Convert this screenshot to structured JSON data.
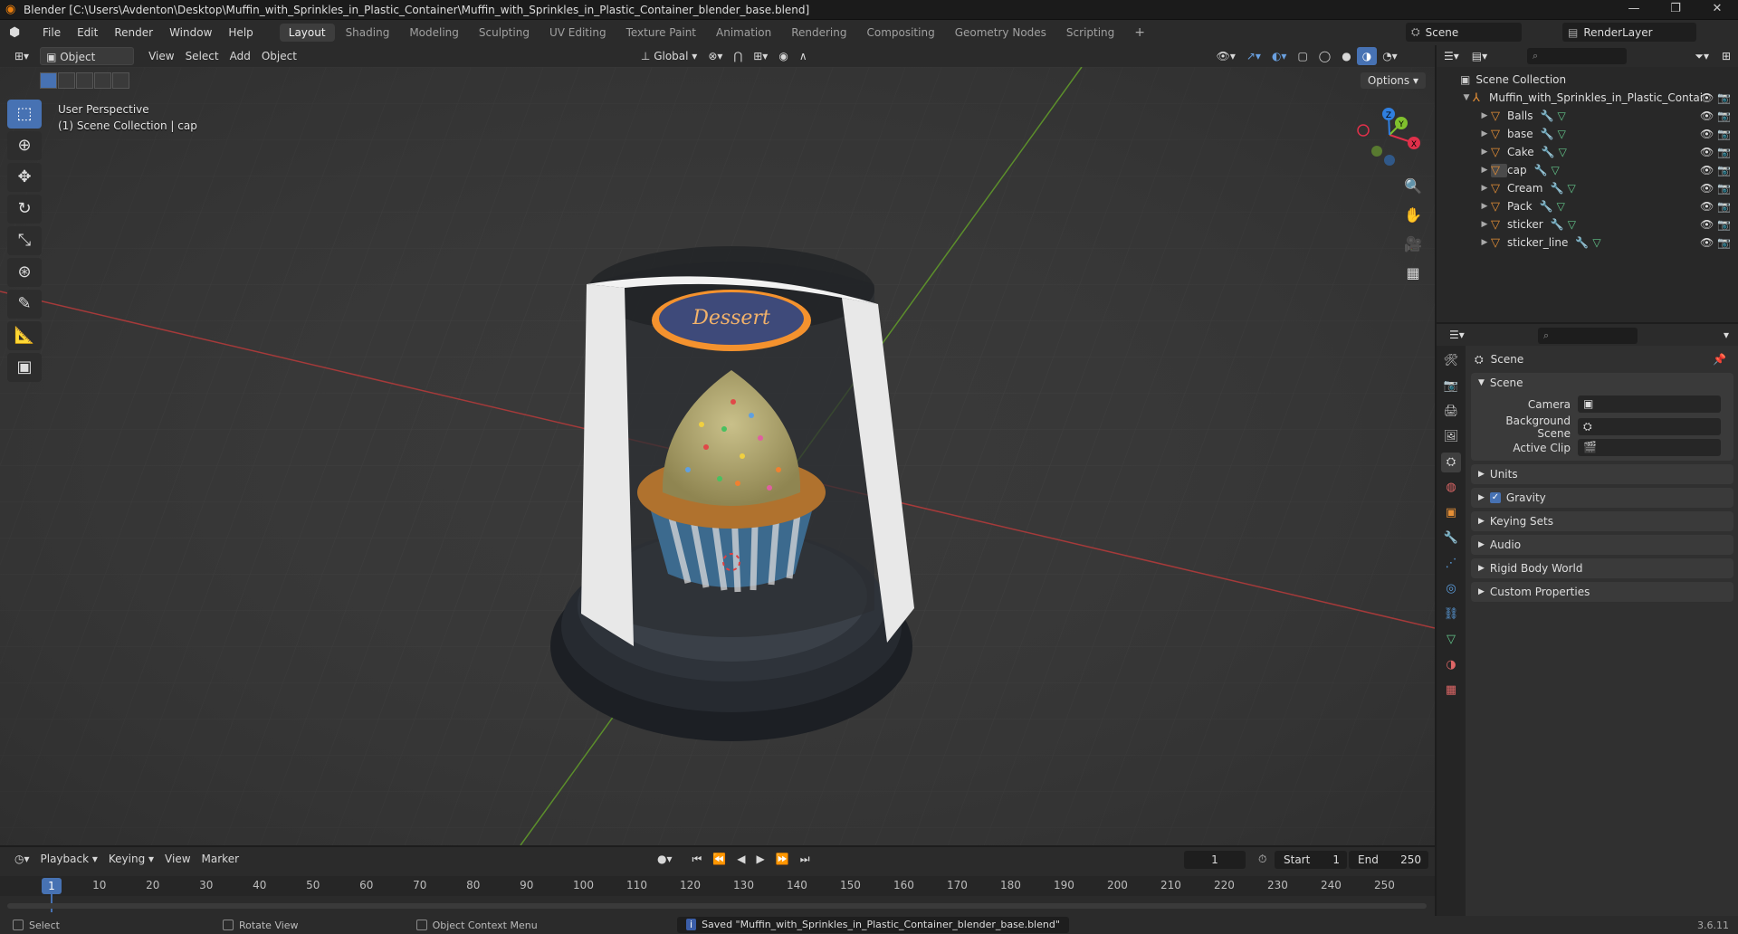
{
  "window": {
    "title": "Blender [C:\\Users\\Avdenton\\Desktop\\Muffin_with_Sprinkles_in_Plastic_Container\\Muffin_with_Sprinkles_in_Plastic_Container_blender_base.blend]",
    "minimize": "—",
    "maximize": "❐",
    "close": "✕"
  },
  "menu": [
    "File",
    "Edit",
    "Render",
    "Window",
    "Help"
  ],
  "workspaces": [
    "Layout",
    "Shading",
    "Modeling",
    "Sculpting",
    "UV Editing",
    "Texture Paint",
    "Animation",
    "Rendering",
    "Compositing",
    "Geometry Nodes",
    "Scripting"
  ],
  "workspace_add": "+",
  "scene_selector": "Scene",
  "view_layer": "RenderLayer",
  "header": {
    "mode": "Object Mode",
    "view": "View",
    "select": "Select",
    "add": "Add",
    "object": "Object",
    "transform_orientation": "Global",
    "options": "Options"
  },
  "viewport": {
    "perspective": "User Perspective",
    "collection_info": "(1) Scene Collection | cap",
    "sticker_text": "Dessert"
  },
  "outliner": {
    "search_placeholder": "",
    "root": "Scene Collection",
    "collection": "Muffin_with_Sprinkles_in_Plastic_Contai",
    "items": [
      "Balls",
      "base",
      "Cake",
      "cap",
      "Cream",
      "Pack",
      "sticker",
      "sticker_line"
    ],
    "selected": "cap"
  },
  "properties": {
    "context": "Scene",
    "panel_scene": "Scene",
    "camera_label": "Camera",
    "background_scene_label": "Background Scene",
    "active_clip_label": "Active Clip",
    "panels": [
      "Units",
      "Gravity",
      "Keying Sets",
      "Audio",
      "Rigid Body World",
      "Custom Properties"
    ]
  },
  "timeline": {
    "playback": "Playback",
    "keying": "Keying",
    "view": "View",
    "marker": "Marker",
    "current_frame": "1",
    "start_label": "Start",
    "start": "1",
    "end_label": "End",
    "end": "250",
    "ticks": [
      "1",
      "10",
      "20",
      "30",
      "40",
      "50",
      "60",
      "70",
      "80",
      "90",
      "100",
      "110",
      "120",
      "130",
      "140",
      "150",
      "160",
      "170",
      "180",
      "190",
      "200",
      "210",
      "220",
      "230",
      "240",
      "250"
    ]
  },
  "status": {
    "select": "Select",
    "rotate_view": "Rotate View",
    "context_menu": "Object Context Menu",
    "saved_message": "Saved \"Muffin_with_Sprinkles_in_Plastic_Container_blender_base.blend\"",
    "version": "3.6.11"
  },
  "colors": {
    "accent": "#4772b3",
    "object_icon": "#e58f36",
    "axis_x": "#e0304a",
    "axis_y": "#80c12d",
    "axis_z": "#2f7fe0"
  }
}
